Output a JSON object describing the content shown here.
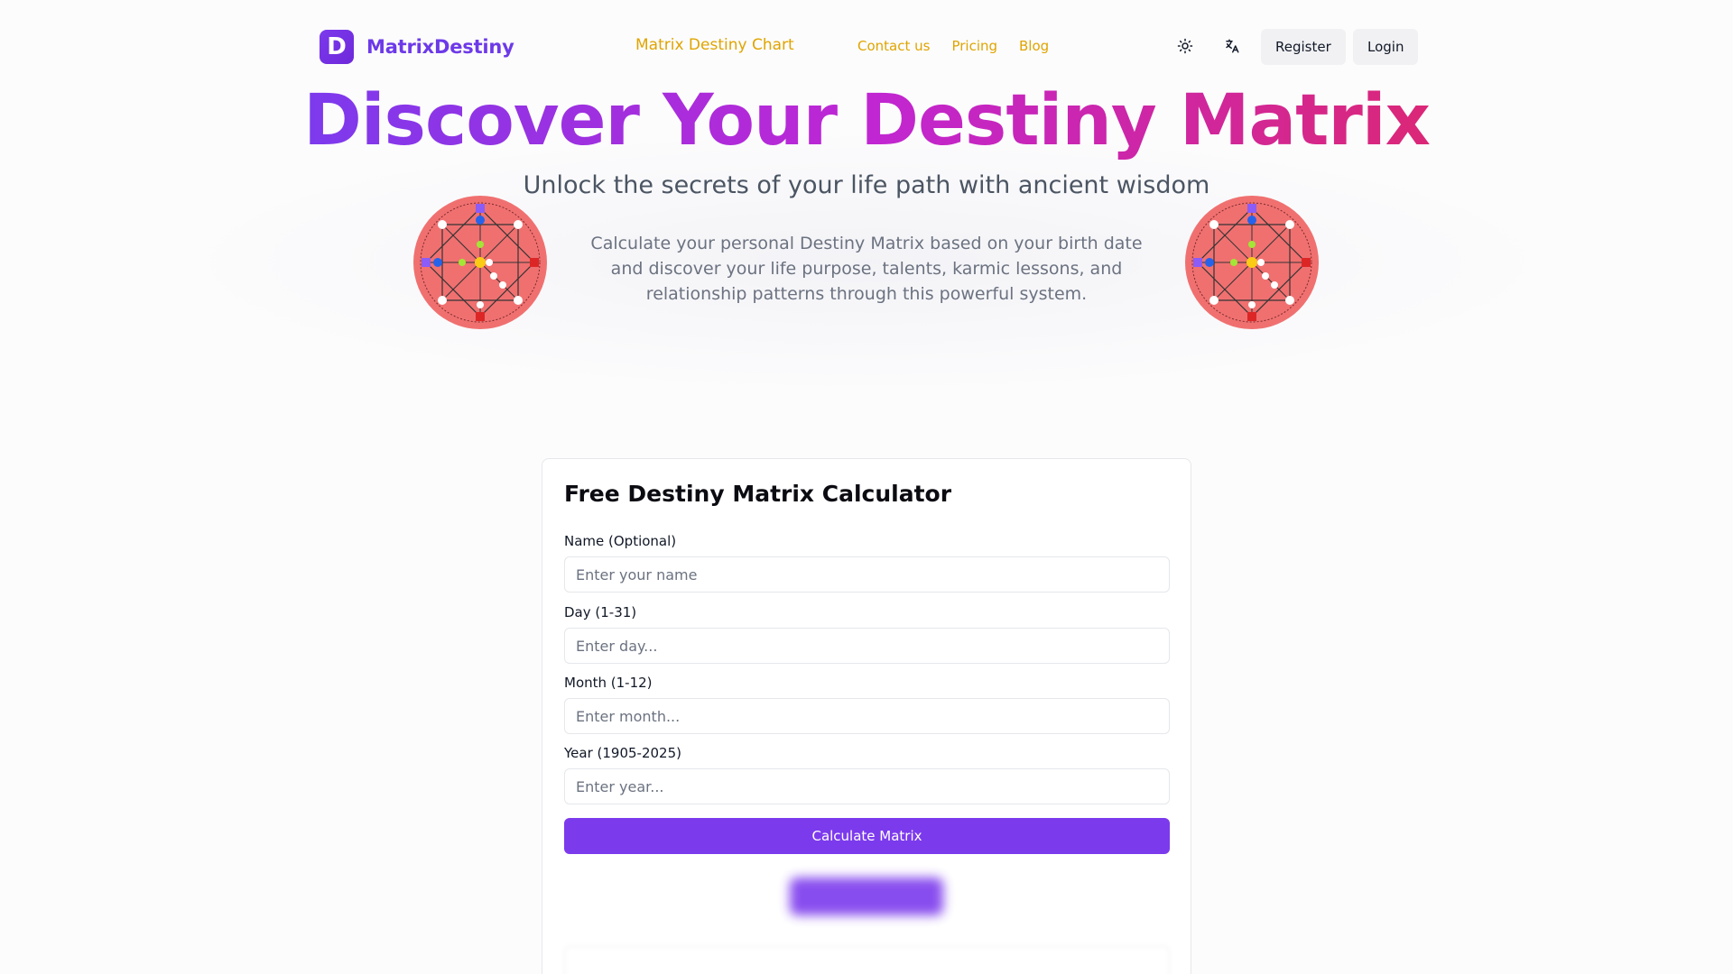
{
  "header": {
    "brand_logo_letter": "D",
    "brand_name": "MatrixDestiny",
    "nav_chart": "Matrix Destiny Chart",
    "nav_links": [
      "Contact us",
      "Pricing",
      "Blog"
    ],
    "theme_icon": "sun-icon",
    "language_icon": "translate-icon",
    "register_label": "Register",
    "login_label": "Login"
  },
  "hero": {
    "title": "Discover Your Destiny Matrix",
    "subtitle": "Unlock the secrets of your life path with ancient wisdom",
    "description": "Calculate your personal Destiny Matrix based on your birth date and discover your life purpose, talents, karmic lessons, and relationship patterns through this powerful system."
  },
  "calculator": {
    "title": "Free Destiny Matrix Calculator",
    "fields": [
      {
        "label": "Name (Optional)",
        "placeholder": "Enter your name"
      },
      {
        "label": "Day (1-31)",
        "placeholder": "Enter day..."
      },
      {
        "label": "Month (1-12)",
        "placeholder": "Enter month..."
      },
      {
        "label": "Year (1905-2025)",
        "placeholder": "Enter year..."
      }
    ],
    "submit_label": "Calculate Matrix"
  },
  "colors": {
    "accent": "#7c3aed",
    "nav_link": "#e0a400",
    "gradient_start": "#7c3aed",
    "gradient_end": "#db2777"
  }
}
